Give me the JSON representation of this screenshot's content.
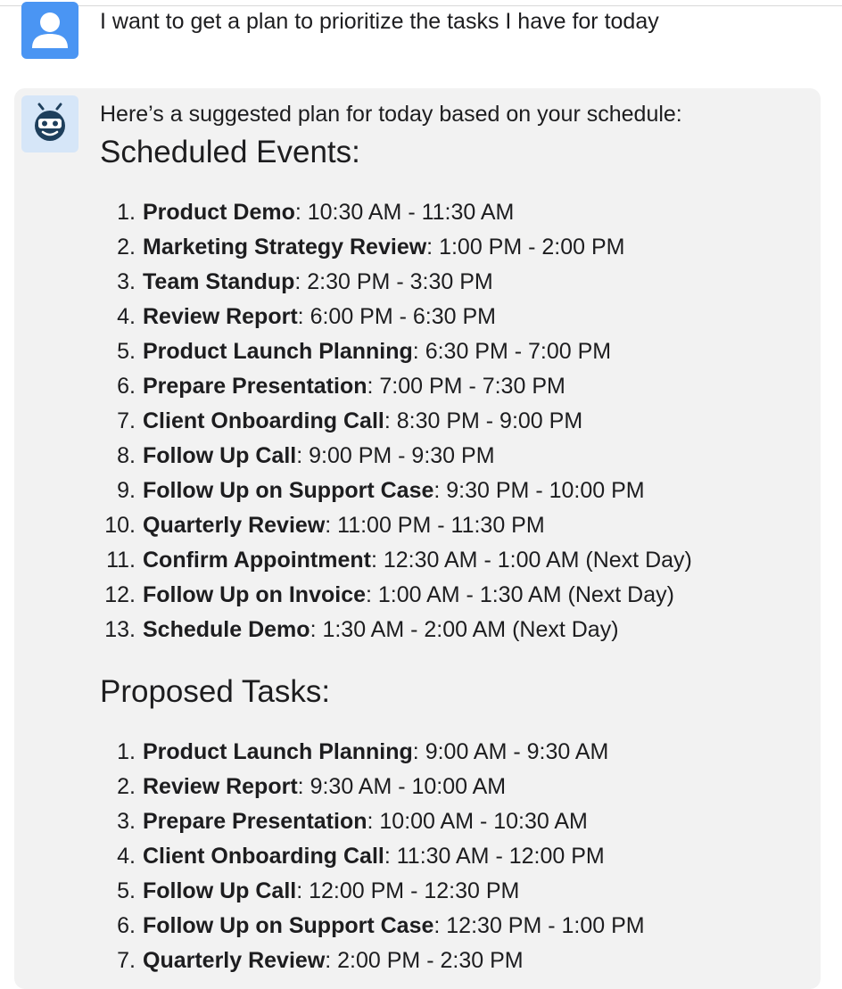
{
  "user_message": "I want to get a plan to prioritize the tasks I have for today",
  "assistant": {
    "intro": "Here’s a suggested plan for today based on your schedule:",
    "scheduled_heading": "Scheduled Events:",
    "scheduled_events": [
      {
        "num": "1.",
        "name": "Product Demo",
        "time": ": 10:30 AM - 11:30 AM"
      },
      {
        "num": "2.",
        "name": "Marketing Strategy Review",
        "time": ": 1:00 PM - 2:00 PM"
      },
      {
        "num": "3.",
        "name": "Team Standup",
        "time": ": 2:30 PM - 3:30 PM"
      },
      {
        "num": "4.",
        "name": "Review Report",
        "time": ": 6:00 PM - 6:30 PM"
      },
      {
        "num": "5.",
        "name": "Product Launch Planning",
        "time": ": 6:30 PM - 7:00 PM"
      },
      {
        "num": "6.",
        "name": "Prepare Presentation",
        "time": ": 7:00 PM - 7:30 PM"
      },
      {
        "num": "7.",
        "name": "Client Onboarding Call",
        "time": ": 8:30 PM - 9:00 PM"
      },
      {
        "num": "8.",
        "name": "Follow Up Call",
        "time": ": 9:00 PM - 9:30 PM"
      },
      {
        "num": "9.",
        "name": "Follow Up on Support Case",
        "time": ": 9:30 PM - 10:00 PM"
      },
      {
        "num": "10.",
        "name": "Quarterly Review",
        "time": ": 11:00 PM - 11:30 PM"
      },
      {
        "num": "11.",
        "name": "Confirm Appointment",
        "time": ": 12:30 AM - 1:00 AM (Next Day)"
      },
      {
        "num": "12.",
        "name": "Follow Up on Invoice",
        "time": ": 1:00 AM - 1:30 AM (Next Day)"
      },
      {
        "num": "13.",
        "name": "Schedule Demo",
        "time": ": 1:30 AM - 2:00 AM (Next Day)"
      }
    ],
    "tasks_heading": "Proposed Tasks:",
    "proposed_tasks": [
      {
        "num": "1.",
        "name": "Product Launch Planning",
        "time": ": 9:00 AM - 9:30 AM"
      },
      {
        "num": "2.",
        "name": "Review Report",
        "time": ": 9:30 AM - 10:00 AM"
      },
      {
        "num": "3.",
        "name": "Prepare Presentation",
        "time": ": 10:00 AM - 10:30 AM"
      },
      {
        "num": "4.",
        "name": "Client Onboarding Call",
        "time": ": 11:30 AM - 12:00 PM"
      },
      {
        "num": "5.",
        "name": "Follow Up Call",
        "time": ": 12:00 PM - 12:30 PM"
      },
      {
        "num": "6.",
        "name": "Follow Up on Support Case",
        "time": ": 12:30 PM - 1:00 PM"
      },
      {
        "num": "7.",
        "name": "Quarterly Review",
        "time": ": 2:00 PM - 2:30 PM"
      }
    ]
  },
  "icons": {
    "user": "user-avatar-icon",
    "assistant": "robot-avatar-icon"
  },
  "colors": {
    "user_avatar_bg": "#4a95f3",
    "assistant_avatar_bg": "#d6e6f8",
    "assistant_bubble_bg": "#f2f2f2",
    "robot_face": "#1e3f5c"
  }
}
